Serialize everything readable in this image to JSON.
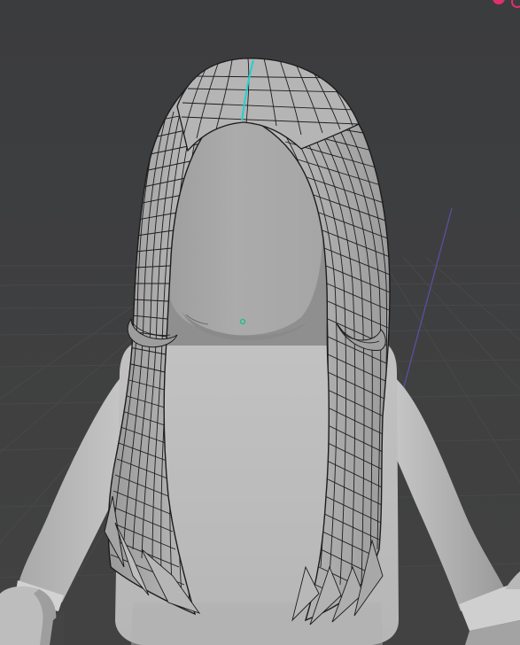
{
  "viewport": {
    "kind": "3d-viewport",
    "mode": "edit-mesh",
    "background_color": "#3d3d3d",
    "grid_color": "#484848",
    "axis_color": "#5a4fa0"
  },
  "scene": {
    "character": {
      "body_color": "#bcbcbc",
      "head_color": "#a3a3a3",
      "shadow_color": "#8e8e8e"
    },
    "hair_mesh": {
      "fill_color": "#b0b0b0",
      "wire_color": "#1c1c1c",
      "selected_edge_color": "#22d0d0"
    },
    "origin_point": {
      "color": "#18c080"
    }
  },
  "gizmo": {
    "corner_widget_color": "#e0306a"
  }
}
